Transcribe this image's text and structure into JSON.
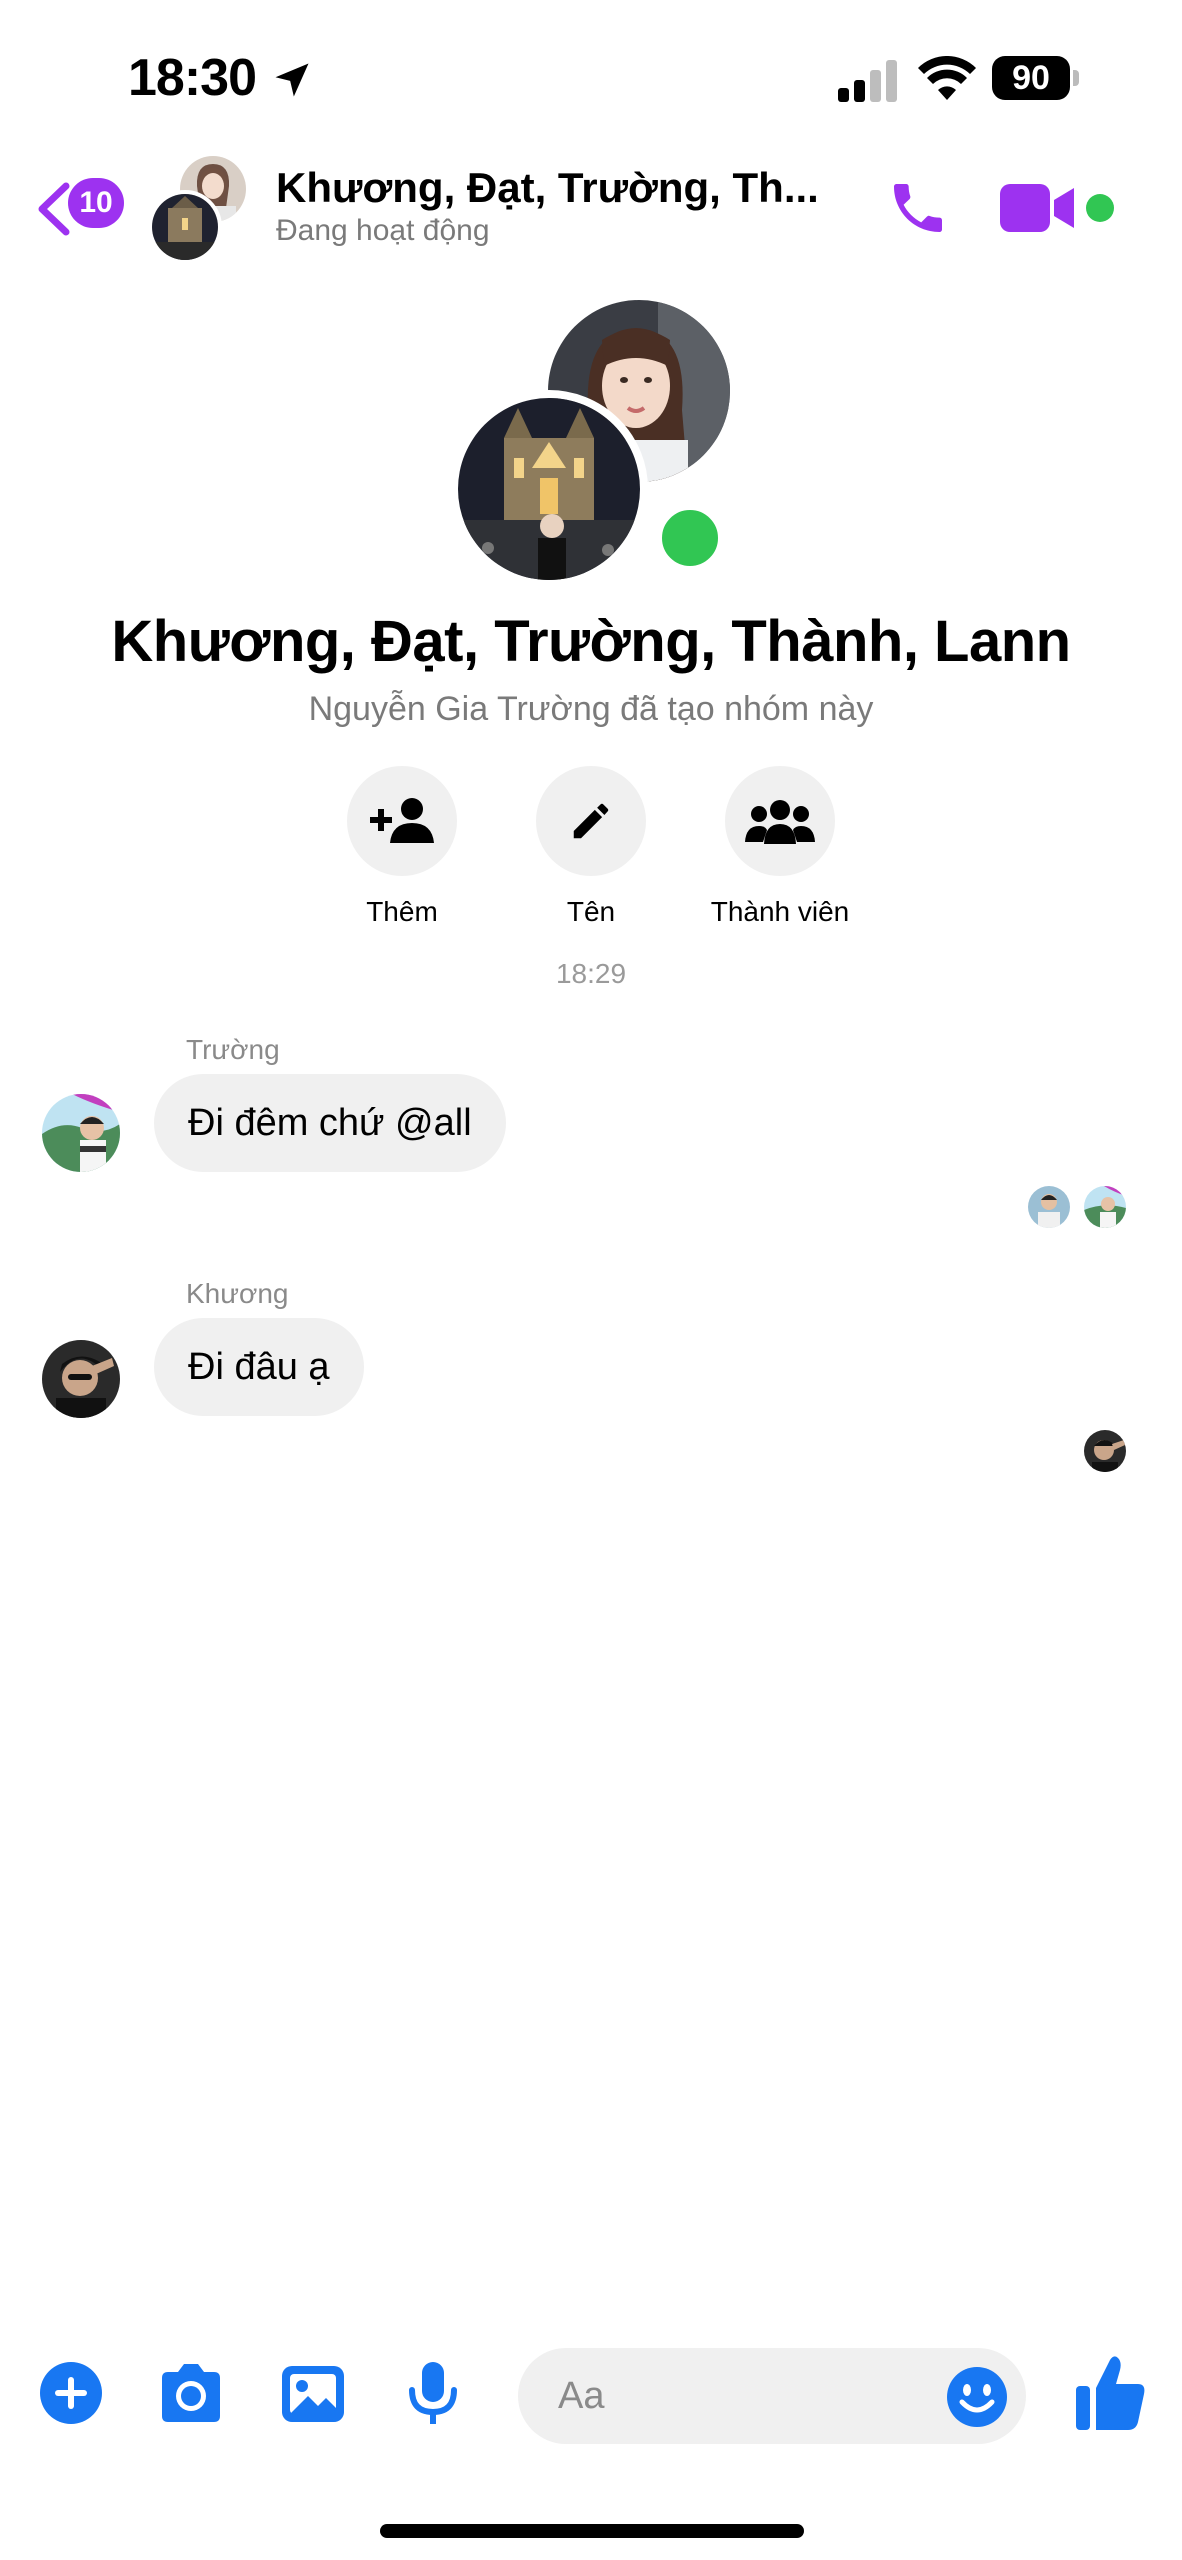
{
  "status_bar": {
    "time": "18:30",
    "battery": "90"
  },
  "header": {
    "back_badge": "10",
    "title": "Khương, Đạt, Trường, Th...",
    "subtitle": "Đang hoạt động",
    "accent": "#9d32f0",
    "online_color": "#31c653"
  },
  "group": {
    "name": "Khương, Đạt, Trường, Thành, Lann",
    "created_by": "Nguyễn Gia Trường đã tạo nhóm này",
    "actions": [
      {
        "label": "Thêm",
        "icon": "add-person-icon"
      },
      {
        "label": "Tên",
        "icon": "pencil-icon"
      },
      {
        "label": "Thành viên",
        "icon": "group-icon"
      }
    ]
  },
  "timestamp": "18:29",
  "messages": [
    {
      "sender": "Trường",
      "text": "Đi đêm chứ @all"
    },
    {
      "sender": "Khương",
      "text": "Đi đâu ạ"
    }
  ],
  "composer": {
    "placeholder": "Aa",
    "icon_color": "#1877f2"
  }
}
